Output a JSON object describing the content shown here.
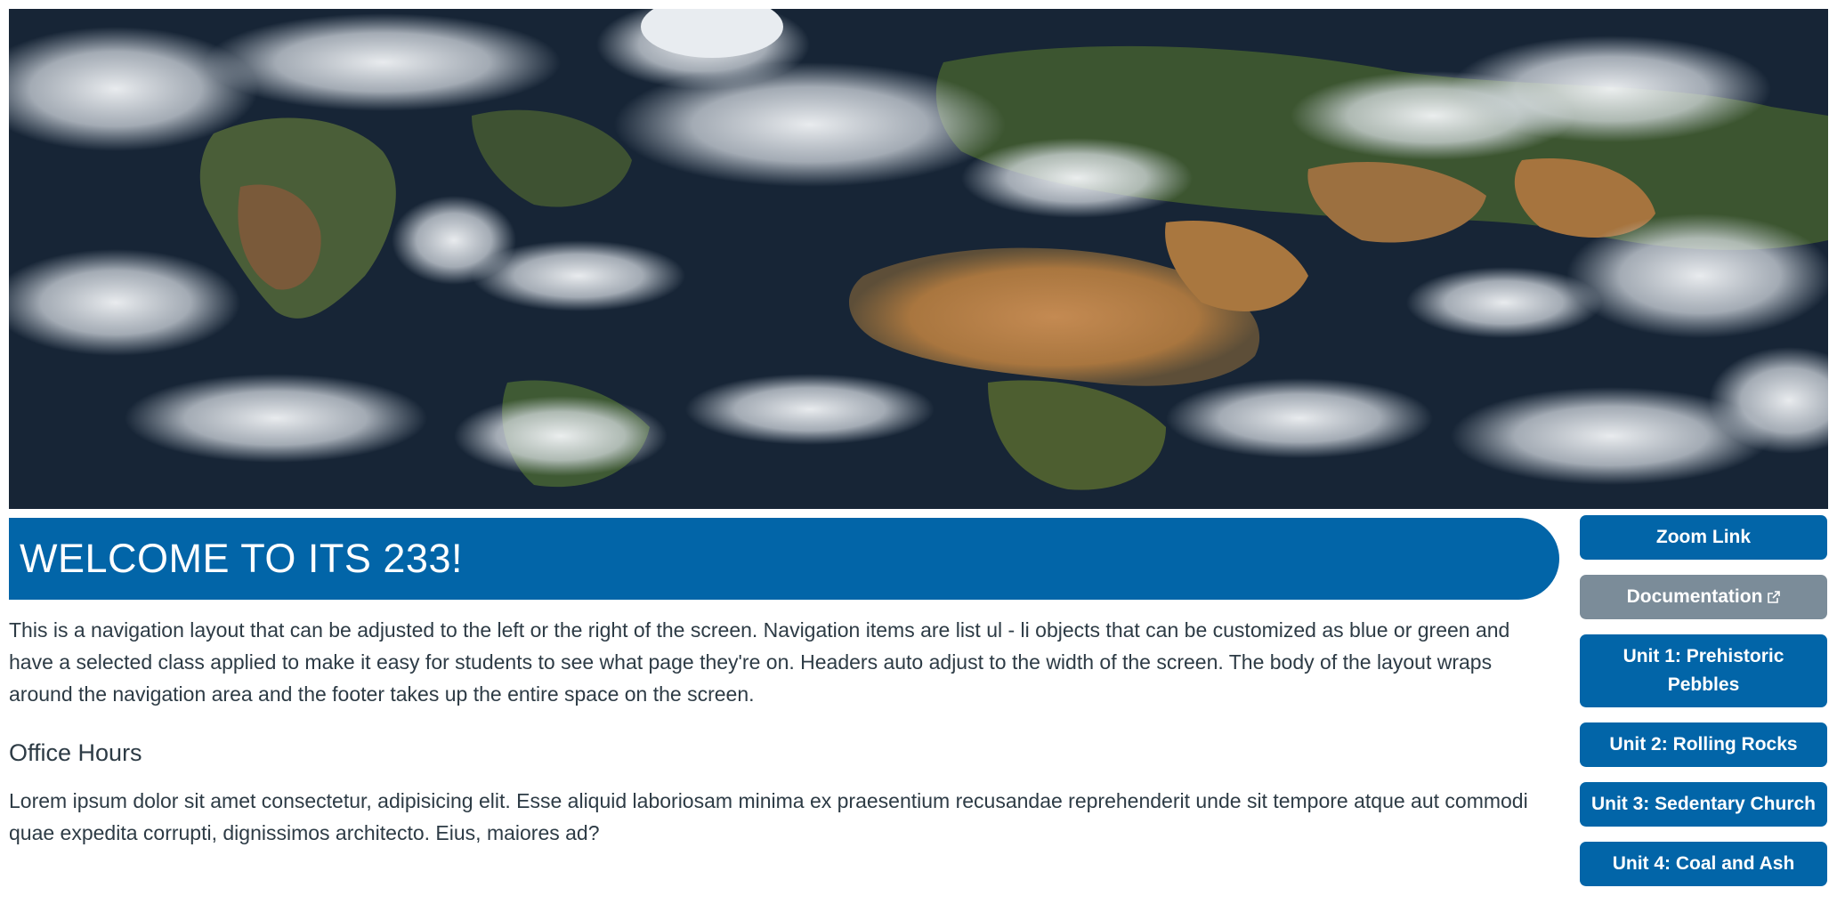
{
  "header": {
    "title": "WELCOME TO ITS 233!"
  },
  "main": {
    "intro": "This is a navigation layout that can be adjusted to the left or the right of the screen. Navigation items are list ul - li objects that can be customized as blue or green and have a selected class applied to make it easy for students to see what page they're on. Headers auto adjust to the width of the screen. The body of the layout wraps around the navigation area and the footer takes up the entire space on the screen.",
    "office_hours_heading": "Office Hours",
    "office_hours_text": "Lorem ipsum dolor sit amet consectetur, adipisicing elit. Esse aliquid laboriosam minima ex praesentium recusandae reprehenderit unde sit tempore atque aut commodi quae expedita corrupti, dignissimos architecto. Eius, maiores ad?"
  },
  "nav": {
    "items": [
      {
        "label": "Zoom Link",
        "selected": false
      },
      {
        "label": "Documentation",
        "selected": true,
        "icon": "external-link-icon"
      },
      {
        "label": "Unit 1: Prehistoric Pebbles",
        "selected": false
      },
      {
        "label": "Unit 2: Rolling Rocks",
        "selected": false
      },
      {
        "label": "Unit 3: Sedentary Church",
        "selected": false
      },
      {
        "label": "Unit 4: Coal and Ash",
        "selected": false
      }
    ]
  },
  "colors": {
    "primary_blue": "#0265a8",
    "selected_gray": "#7b8c99",
    "text": "#2d3b45",
    "background": "#ffffff"
  }
}
